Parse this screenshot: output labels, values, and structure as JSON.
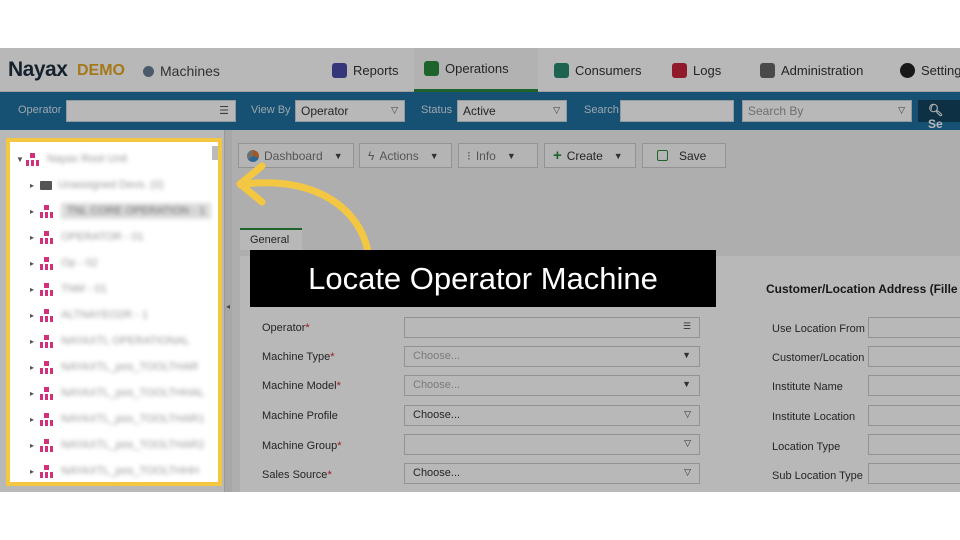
{
  "brand": {
    "logo": "Nayax",
    "demo": "DEMO",
    "module": "Machines"
  },
  "nav": [
    {
      "label": "Reports",
      "icon": "reports-icon",
      "color": "#4a4aa8"
    },
    {
      "label": "Operations",
      "icon": "operations-icon",
      "color": "#2a8a3e",
      "active": true
    },
    {
      "label": "Consumers",
      "icon": "consumers-icon",
      "color": "#2a8a6e"
    },
    {
      "label": "Logs",
      "icon": "logs-icon",
      "color": "#c8243b"
    },
    {
      "label": "Administration",
      "icon": "administration-icon",
      "color": "#666666"
    },
    {
      "label": "Settings",
      "icon": "settings-icon",
      "color": "#222222"
    }
  ],
  "filters": {
    "operator_label": "Operator",
    "viewby_label": "View By",
    "viewby_value": "Operator",
    "status_label": "Status",
    "status_value": "Active",
    "search_label": "Search",
    "searchby_placeholder": "Search By",
    "search_button": "Se"
  },
  "tree": {
    "root": "Nayax Root Unit",
    "items": [
      "Unassigned Devs. (0)",
      "TNL CORE OPERATION - 1",
      "OPERATOR - 01",
      "Op - 02",
      "TNM - 01",
      "ALTNAYEO2R - 1",
      "NAYAXTL OPERATIONAL",
      "NAYAXTL_pos_TOOLTHAR",
      "NAYAXTL_pos_TOOLTHHAL",
      "NAYAXTL_pos_TOOLTHAR1",
      "NAYAXTL_pos_TOOLTHAR2",
      "NAYAXTL_pos_TOOLTHHH"
    ]
  },
  "toolbar": {
    "dashboard": "Dashboard",
    "actions": "Actions",
    "info": "Info",
    "create": "Create",
    "save": "Save"
  },
  "tab_general": "General",
  "form": {
    "fields": [
      {
        "label": "Operator",
        "required": true,
        "value": "",
        "kind": "list"
      },
      {
        "label": "Machine Type",
        "required": true,
        "value": "Choose...",
        "placeholder": true
      },
      {
        "label": "Machine Model",
        "required": true,
        "value": "Choose...",
        "placeholder": true
      },
      {
        "label": "Machine Profile",
        "required": false,
        "value": "Choose...",
        "placeholder": false
      },
      {
        "label": "Machine Group",
        "required": true,
        "value": "",
        "placeholder": false
      },
      {
        "label": "Sales Source",
        "required": true,
        "value": "Choose...",
        "placeholder": false
      }
    ]
  },
  "address": {
    "title": "Customer/Location Address (Fille",
    "fields": [
      "Use Location From",
      "Customer/Location",
      "Institute Name",
      "Institute Location",
      "Location Type",
      "Sub Location Type"
    ]
  },
  "callout": {
    "text": "Locate Operator Machine"
  },
  "colors": {
    "highlight": "#f4c742",
    "filterbar": "#1f6f9e",
    "accent_green": "#2a8a3e"
  }
}
